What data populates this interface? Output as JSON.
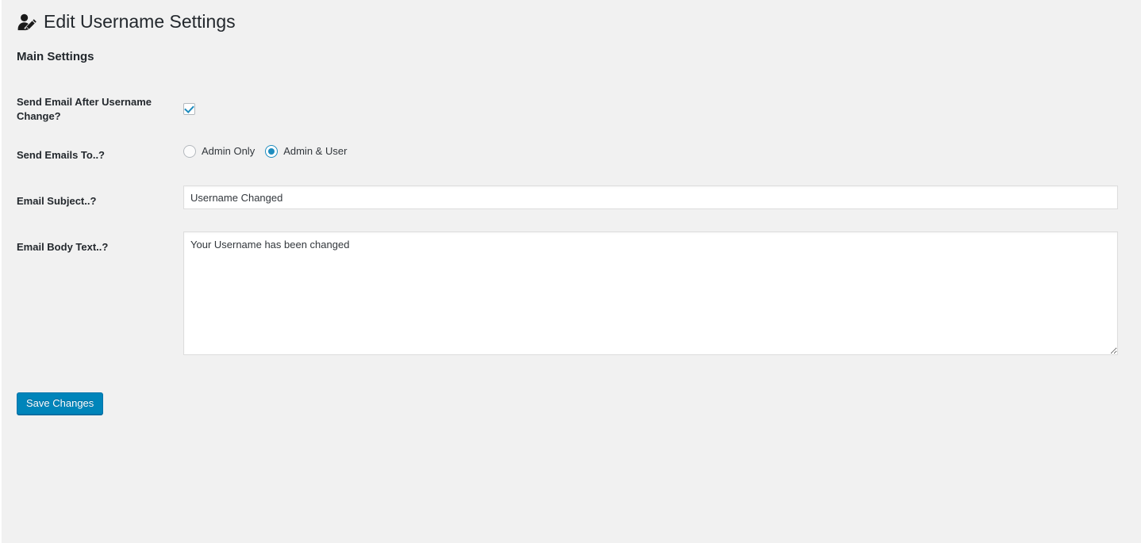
{
  "header": {
    "icon": "user-edit-icon",
    "title": "Edit Username Settings"
  },
  "section": {
    "heading": "Main Settings"
  },
  "form": {
    "send_email": {
      "label": "Send Email After Username Change?",
      "checkbox_checked": "true",
      "checkbox_name": "send-email-after-change-checkbox"
    },
    "send_emails_to": {
      "label": "Send Emails To..?",
      "options": [
        {
          "label": "Admin Only",
          "selected": "false"
        },
        {
          "label": "Admin & User",
          "selected": "true"
        }
      ]
    },
    "email_subject": {
      "label": "Email Subject..?",
      "value": "Username Changed",
      "placeholder": ""
    },
    "email_body": {
      "label": "Email Body Text..?",
      "value": "Your Username has been changed",
      "placeholder": ""
    }
  },
  "actions": {
    "save_label": "Save Changes"
  },
  "colors": {
    "page_background": "#f1f1f1",
    "accent_blue": "#0085ba",
    "control_blue": "#1e8cbe",
    "text_dark": "#23282d",
    "border_light": "#dddddd"
  }
}
